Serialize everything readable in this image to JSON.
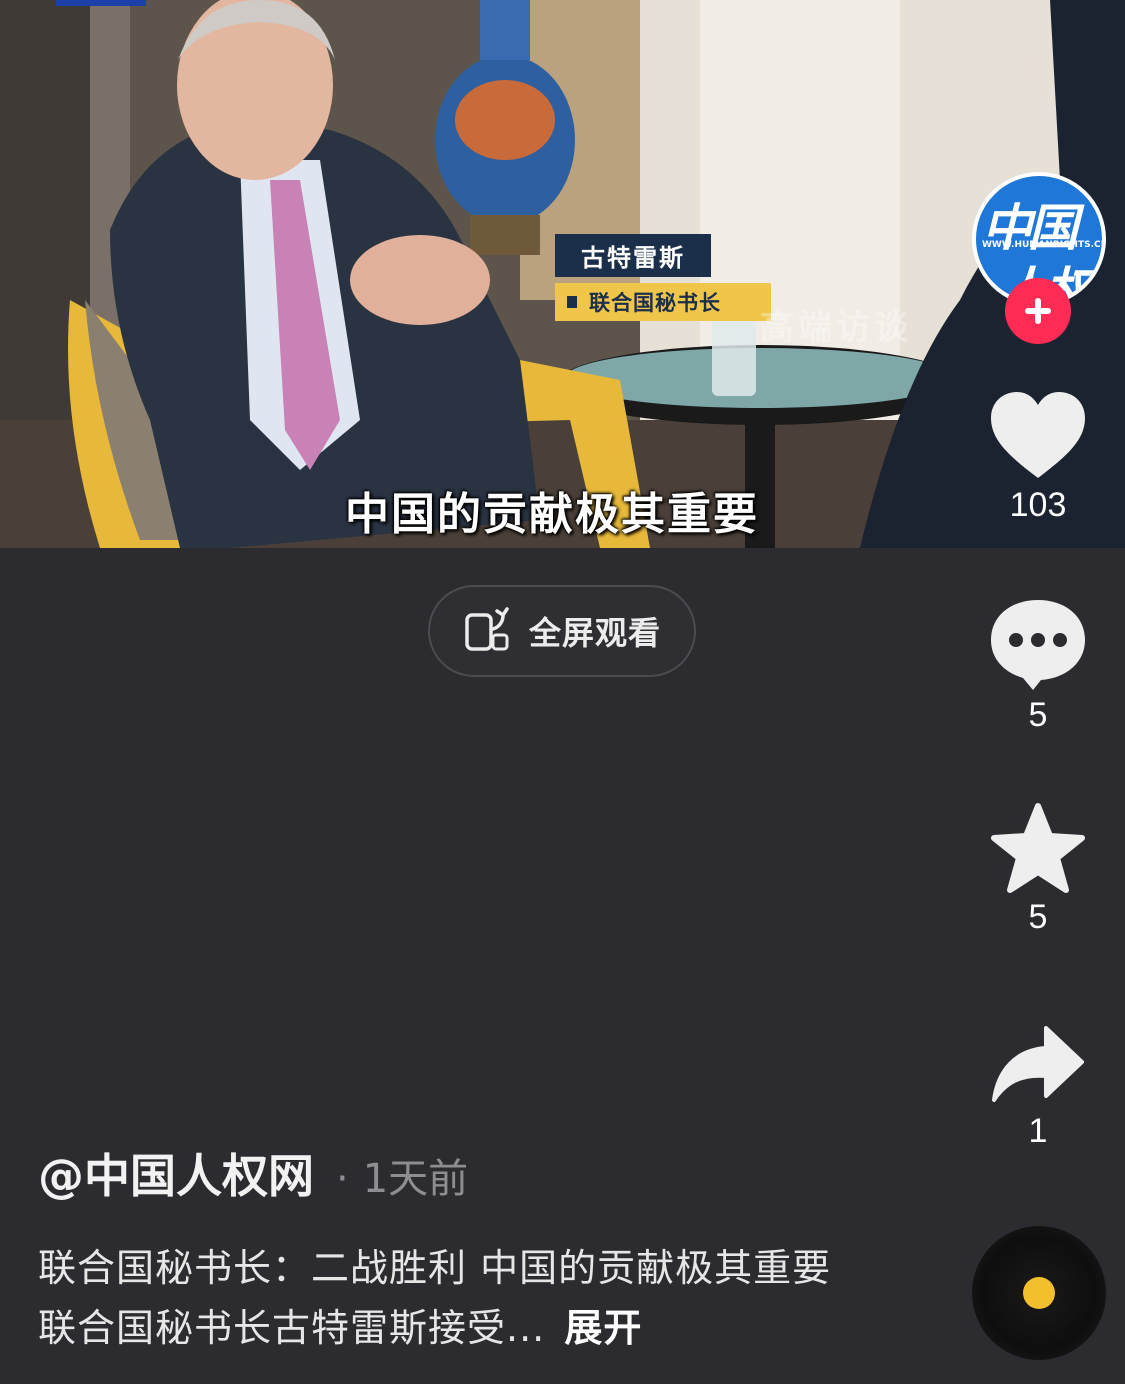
{
  "video": {
    "name_card": {
      "name": "古特雷斯",
      "role": "联合国秘书长"
    },
    "watermark": "高端访谈",
    "subtitle": "中国的贡献极其重要"
  },
  "fullscreen_button": {
    "label": "全屏观看",
    "icon": "rotate-screen-icon"
  },
  "account": {
    "avatar_text_top": "中国",
    "avatar_url_text": "WWW.HUMANRIGHTS.CN",
    "avatar_text_bottom": "人权",
    "follow_icon": "plus-icon"
  },
  "actions": {
    "like": {
      "icon": "heart-icon",
      "count": "103"
    },
    "comment": {
      "icon": "chat-bubble-icon",
      "count": "5"
    },
    "favorite": {
      "icon": "star-icon",
      "count": "5"
    },
    "share": {
      "icon": "share-arrow-icon",
      "count": "1"
    }
  },
  "post": {
    "author": "@中国人权网",
    "separator": "·",
    "time": "1天前",
    "description": "联合国秘书长：二战胜利 中国的贡献极其重要 联合国秘书长古特雷斯接受...",
    "expand_label": "展开"
  },
  "colors": {
    "background": "#2c2c30",
    "follow_red": "#fe2c55",
    "disc_yellow": "#f2c02d"
  }
}
